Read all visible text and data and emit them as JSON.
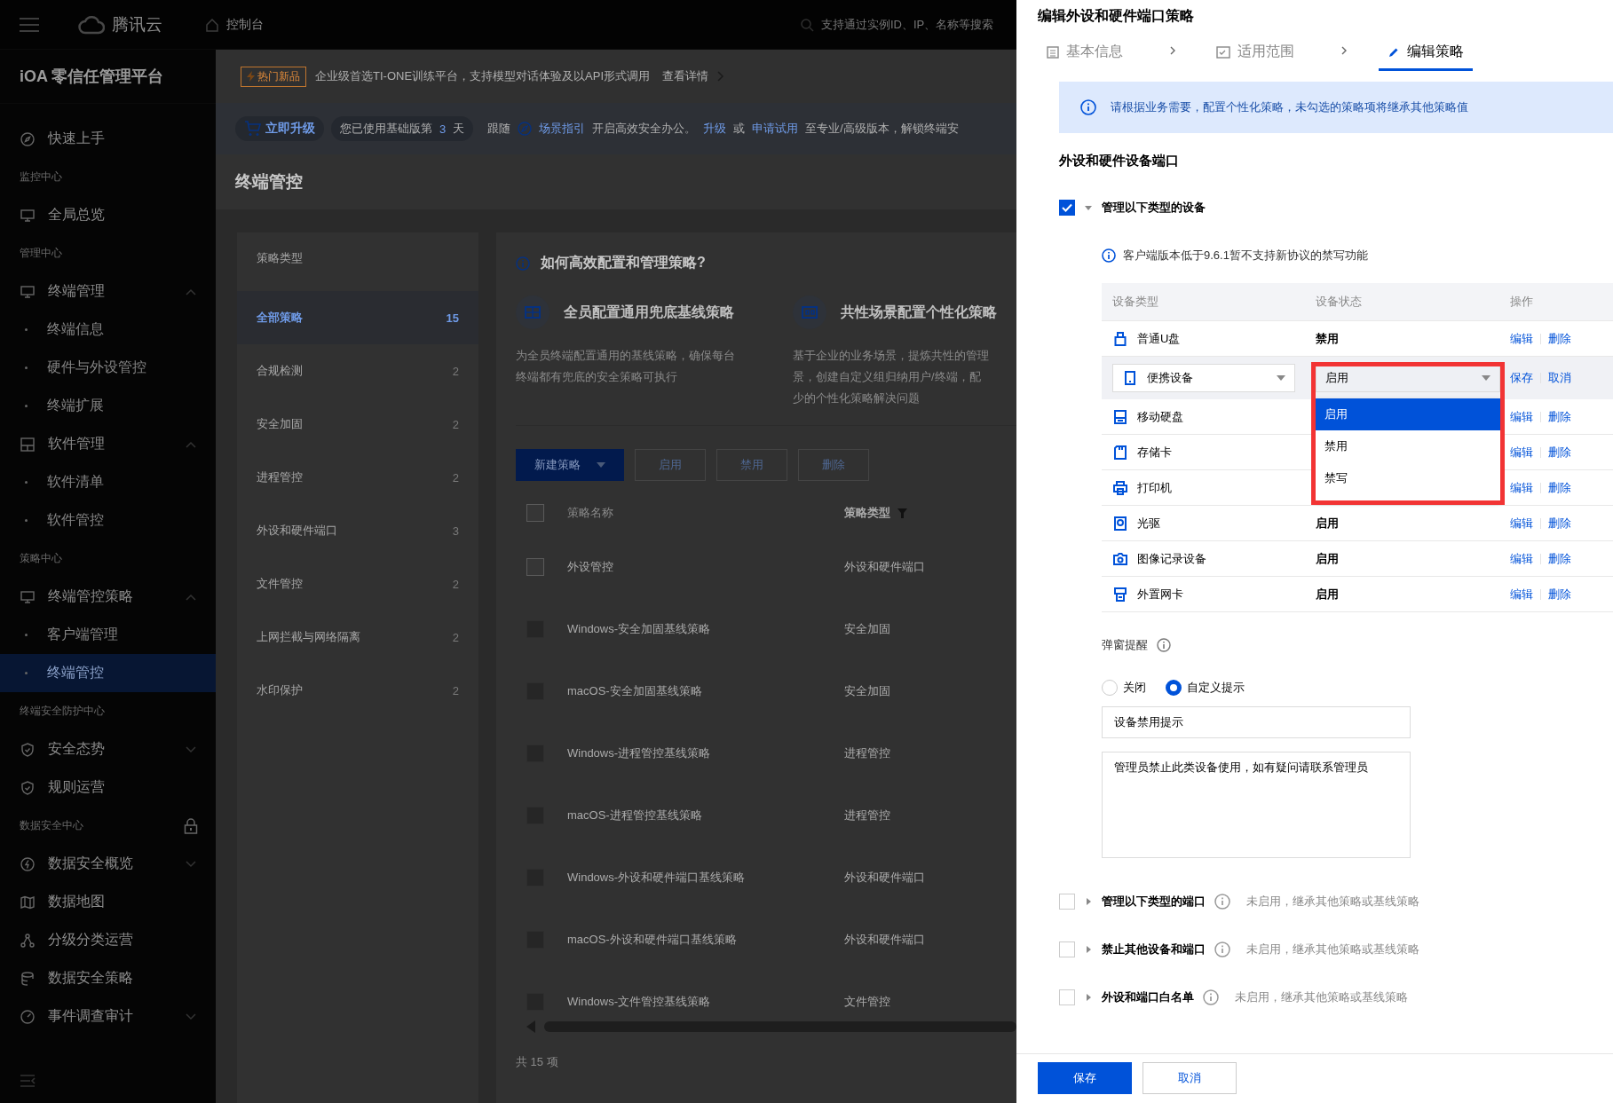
{
  "top_bar": {
    "brand": "腾讯云",
    "console": "控制台",
    "search_placeholder": "支持通过实例ID、IP、名称等搜索"
  },
  "sidebar": {
    "title": "iOA 零信任管理平台",
    "items": [
      {
        "kind": "item",
        "label": "快速上手",
        "selected": false
      },
      {
        "kind": "group",
        "label": "监控中心"
      },
      {
        "kind": "item",
        "label": "全局总览",
        "selected": false
      },
      {
        "kind": "group",
        "label": "管理中心"
      },
      {
        "kind": "item",
        "label": "终端管理",
        "selected": false,
        "expanded": true
      },
      {
        "kind": "sub",
        "label": "终端信息",
        "selected": false
      },
      {
        "kind": "sub",
        "label": "硬件与外设管控",
        "selected": false
      },
      {
        "kind": "sub",
        "label": "终端扩展",
        "selected": false
      },
      {
        "kind": "item",
        "label": "软件管理",
        "selected": false,
        "expanded": true
      },
      {
        "kind": "sub",
        "label": "软件清单",
        "selected": false
      },
      {
        "kind": "sub",
        "label": "软件管控",
        "selected": false
      },
      {
        "kind": "group",
        "label": "策略中心"
      },
      {
        "kind": "item",
        "label": "终端管控策略",
        "selected": false,
        "expanded": true
      },
      {
        "kind": "sub",
        "label": "客户端管理",
        "selected": false
      },
      {
        "kind": "sub",
        "label": "终端管控",
        "selected": true
      },
      {
        "kind": "group",
        "label": "终端安全防护中心"
      },
      {
        "kind": "item",
        "label": "安全态势",
        "selected": false,
        "expanded": false
      },
      {
        "kind": "item",
        "label": "规则运营",
        "selected": false
      },
      {
        "kind": "group",
        "label": "数据安全中心",
        "locked": true
      },
      {
        "kind": "item",
        "label": "数据安全概览",
        "selected": false,
        "expanded": false
      },
      {
        "kind": "item",
        "label": "数据地图",
        "selected": false
      },
      {
        "kind": "item",
        "label": "分级分类运营",
        "selected": false
      },
      {
        "kind": "item",
        "label": "数据安全策略",
        "selected": false
      },
      {
        "kind": "item",
        "label": "事件调查审计",
        "selected": false,
        "expanded": false
      }
    ]
  },
  "promo": {
    "tag": "热门新品",
    "text": "企业级首选TI-ONE训练平台，支持模型对话体验及以API形式调用",
    "link": "查看详情"
  },
  "upgrade_bar": {
    "button": "立即升级",
    "usage_prefix": "您已使用基础版第",
    "usage_days": "3",
    "usage_suffix": "天",
    "segments": [
      {
        "kind": "text",
        "text": "跟随"
      },
      {
        "kind": "guide",
        "text": "场景指引"
      },
      {
        "kind": "text",
        "text": "开启高效安全办公。"
      },
      {
        "kind": "link",
        "text": "升级"
      },
      {
        "kind": "text",
        "text": "或"
      },
      {
        "kind": "link",
        "text": "申请试用"
      },
      {
        "kind": "text",
        "text": "至专业/高级版本，解锁终端安"
      }
    ]
  },
  "page_title": "终端管控",
  "categories": {
    "heading": "策略类型",
    "items": [
      {
        "label": "全部策略",
        "count": "15",
        "selected": true
      },
      {
        "label": "合规检测",
        "count": "2",
        "selected": false
      },
      {
        "label": "安全加固",
        "count": "2",
        "selected": false
      },
      {
        "label": "进程管控",
        "count": "2",
        "selected": false
      },
      {
        "label": "外设和硬件端口",
        "count": "3",
        "selected": false
      },
      {
        "label": "文件管控",
        "count": "2",
        "selected": false
      },
      {
        "label": "上网拦截与网络隔离",
        "count": "2",
        "selected": false
      },
      {
        "label": "水印保护",
        "count": "2",
        "selected": false
      }
    ]
  },
  "guide": {
    "title": "如何高效配置和管理策略?",
    "cards": [
      {
        "title": "全员配置通用兜底基线策略",
        "description_lines": [
          "为全员终端配置通用的基线策略，确保每台",
          "终端都有兜底的安全策略可执行"
        ]
      },
      {
        "title": "共性场景配置个性化策略",
        "description_lines": [
          "基于企业的业务场景，提炼共性的管理",
          "景，创建自定义组归纳用户/终端，配",
          "少的个性化策略解决问题"
        ]
      }
    ]
  },
  "toolbar": {
    "buttons": [
      {
        "label": "新建策略",
        "kind": "dropdown",
        "disabled": false
      },
      {
        "label": "启用",
        "kind": "plain",
        "disabled": true
      },
      {
        "label": "禁用",
        "kind": "plain",
        "disabled": true
      },
      {
        "label": "删除",
        "kind": "plain",
        "disabled": true
      }
    ]
  },
  "policy_table": {
    "columns": [
      "策略名称",
      "策略类型"
    ],
    "select_all_checked": false,
    "rows": [
      {
        "name": "外设管控",
        "type": "外设和硬件端口",
        "checked": false,
        "disabled": false
      },
      {
        "name": "Windows-安全加固基线策略",
        "type": "安全加固",
        "checked": false,
        "disabled": true
      },
      {
        "name": "macOS-安全加固基线策略",
        "type": "安全加固",
        "checked": false,
        "disabled": true
      },
      {
        "name": "Windows-进程管控基线策略",
        "type": "进程管控",
        "checked": false,
        "disabled": true
      },
      {
        "name": "macOS-进程管控基线策略",
        "type": "进程管控",
        "checked": false,
        "disabled": true
      },
      {
        "name": "Windows-外设和硬件端口基线策略",
        "type": "外设和硬件端口",
        "checked": false,
        "disabled": true
      },
      {
        "name": "macOS-外设和硬件端口基线策略",
        "type": "外设和硬件端口",
        "checked": false,
        "disabled": true
      },
      {
        "name": "Windows-文件管控基线策略",
        "type": "文件管控",
        "checked": false,
        "disabled": true
      }
    ],
    "total": "共 15 项"
  },
  "drawer": {
    "title": "编辑外设和硬件端口策略",
    "steps": [
      {
        "label": "基本信息",
        "selected": false
      },
      {
        "label": "适用范围",
        "selected": false
      },
      {
        "label": "编辑策略",
        "selected": true
      }
    ],
    "alert": "请根据业务需要，配置个性化策略，未勾选的策略项将继承其他策略值",
    "section_title": "外设和硬件设备端口",
    "device_group": {
      "label": "管理以下类型的设备",
      "checked": true,
      "expanded": true,
      "note": "客户端版本低于9.6.1暂不支持新协议的禁写功能"
    },
    "device_table": {
      "columns": [
        "设备类型",
        "设备状态",
        "操作"
      ],
      "rows": [
        {
          "name": "普通U盘",
          "status": "禁用",
          "editing": false,
          "actions": [
            "编辑",
            "删除"
          ]
        },
        {
          "name": "便携设备",
          "status": "启用",
          "editing": true,
          "actions": [
            "保存",
            "取消"
          ]
        },
        {
          "name": "移动硬盘",
          "editing": false,
          "actions": [
            "编辑",
            "删除"
          ]
        },
        {
          "name": "存储卡",
          "editing": false,
          "actions": [
            "编辑",
            "删除"
          ]
        },
        {
          "name": "打印机",
          "editing": false,
          "actions": [
            "编辑",
            "删除"
          ]
        },
        {
          "name": "光驱",
          "status": "启用",
          "editing": false,
          "actions": [
            "编辑",
            "删除"
          ]
        },
        {
          "name": "图像记录设备",
          "status": "启用",
          "editing": false,
          "actions": [
            "编辑",
            "删除"
          ]
        },
        {
          "name": "外置网卡",
          "status": "启用",
          "editing": false,
          "actions": [
            "编辑",
            "删除"
          ]
        }
      ]
    },
    "status_menu": {
      "highlighted": true,
      "options": [
        {
          "label": "启用",
          "selected": true
        },
        {
          "label": "禁用",
          "selected": false
        },
        {
          "label": "禁写",
          "selected": false
        }
      ]
    },
    "popup": {
      "label": "弹窗提醒",
      "options": [
        {
          "label": "关闭",
          "selected": false
        },
        {
          "label": "自定义提示",
          "selected": true
        }
      ],
      "title_value": "设备禁用提示",
      "message_value": "管理员禁止此类设备使用，如有疑问请联系管理员"
    },
    "collapsed_groups": [
      {
        "label": "管理以下类型的端口",
        "checked": false,
        "note": "未启用，继承其他策略或基线策略"
      },
      {
        "label": "禁止其他设备和端口",
        "checked": false,
        "note": "未启用，继承其他策略或基线策略"
      },
      {
        "label": "外设和端口白名单",
        "checked": false,
        "note": "未启用，继承其他策略或基线策略"
      }
    ],
    "footer": {
      "buttons": [
        {
          "label": "保存",
          "kind": "primary"
        },
        {
          "label": "取消",
          "kind": "default"
        }
      ]
    }
  }
}
